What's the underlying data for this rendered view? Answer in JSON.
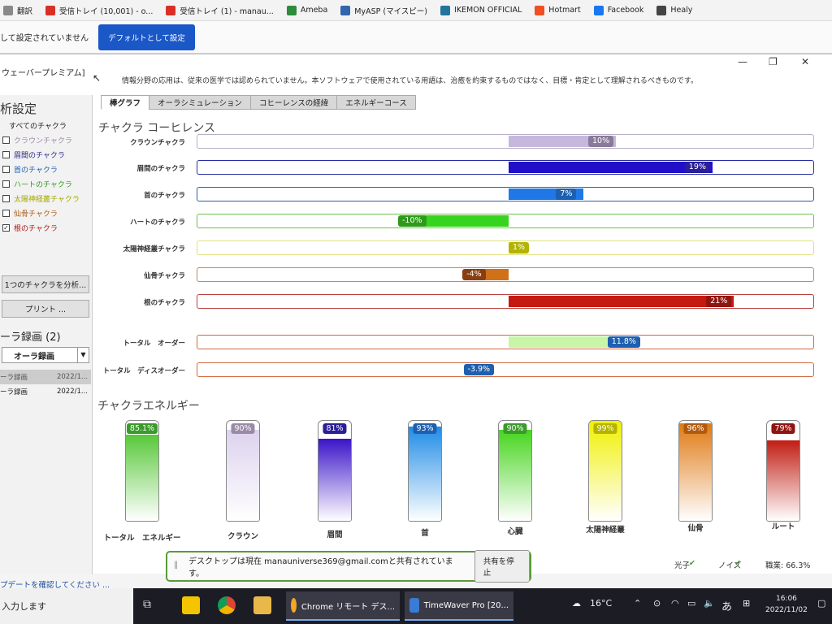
{
  "bookmarks": [
    {
      "label": "翻訳",
      "icon": "translate-icon",
      "color": "#888888"
    },
    {
      "label": "受信トレイ (10,001) - o...",
      "icon": "gmail-icon",
      "color": "#d93025"
    },
    {
      "label": "受信トレイ (1) - manau...",
      "icon": "gmail-icon",
      "color": "#d93025"
    },
    {
      "label": "Ameba",
      "icon": "ameba-icon",
      "color": "#2d8c3c"
    },
    {
      "label": "MyASP (マイスピー)",
      "icon": "myasp-icon",
      "color": "#3366aa"
    },
    {
      "label": "IKEMON OFFICIAL",
      "icon": "wordpress-icon",
      "color": "#21759b"
    },
    {
      "label": "Hotmart",
      "icon": "hotmart-icon",
      "color": "#f04e23"
    },
    {
      "label": "Facebook",
      "icon": "facebook-icon",
      "color": "#1877f2"
    },
    {
      "label": "Healy",
      "icon": "healy-icon",
      "color": "#444444"
    }
  ],
  "infobar": {
    "message": "して設定されていません",
    "button": "デフォルトとして設定"
  },
  "app": {
    "title": "ウェーバープレミアム]",
    "disclaimer": "情報分野の応用は、従来の医学では認められていません。本ソフトウェアで使用されている用語は、治癒を約束するものではなく、目標・肯定として理解されるべきものです。"
  },
  "left": {
    "section_title": "析設定",
    "checks": [
      {
        "label": "すべてのチャクラ",
        "checked": "",
        "color": "#222222"
      },
      {
        "label": "クラウンチャクラ",
        "checked": "",
        "color": "#9a8aa8"
      },
      {
        "label": "眉間のチャクラ",
        "checked": "",
        "color": "#2a2a8a"
      },
      {
        "label": "首のチャクラ",
        "checked": "",
        "color": "#1a5fb4"
      },
      {
        "label": "ハートのチャクラ",
        "checked": "",
        "color": "#2e9a1a"
      },
      {
        "label": "太陽神経叢チャクラ",
        "checked": "",
        "color": "#a8a800"
      },
      {
        "label": "仙骨チャクラ",
        "checked": "",
        "color": "#b05a10"
      },
      {
        "label": "根のチャクラ",
        "checked": "✓",
        "color": "#b01818"
      }
    ],
    "analyze_button": "1つのチャクラを分析...",
    "print_button": "プリント ...",
    "recording_title": "ーラ録画 (2)",
    "recording_select": "オーラ録画",
    "recordings": [
      {
        "name": "ーラ録画",
        "date": "2022/1..."
      },
      {
        "name": "ーラ録画",
        "date": "2022/1..."
      }
    ],
    "footer": "プデートを確認してください ..."
  },
  "tabs": [
    "棒グラフ",
    "オーラシミュレーション",
    "コヒーレンスの経緯",
    "エネルギーコース"
  ],
  "chart_data": [
    {
      "type": "bar",
      "title": "チャクラ コーヒレンス",
      "xlim": [
        -50,
        50
      ],
      "categories": [
        "クラウンチャクラ",
        "眉間のチャクラ",
        "首のチャクラ",
        "ハートのチャクラ",
        "太陽神経叢チャクラ",
        "仙骨チャクラ",
        "根のチャクラ",
        "トータル　オーダー",
        "トータル　ディスオーダー"
      ],
      "values": [
        10,
        19,
        7,
        -10,
        1,
        -4,
        21,
        11.8,
        -3.9
      ],
      "labels": [
        "10%",
        "19%",
        "7%",
        "-10%",
        "1%",
        "-4%",
        "21%",
        "11.8%",
        "-3.9%"
      ],
      "colors": [
        "#c6b8dc",
        "#1f10c8",
        "#1f78e6",
        "#36d41e",
        "#e2e200",
        "#d07018",
        "#c51a10",
        "#c9f5a8",
        "#ffffff"
      ],
      "label_colors": [
        "#8a7a9a",
        "#2a1e9a",
        "#1d5fb0",
        "#2e9a1a",
        "#b3b300",
        "#8a3e10",
        "#8e1510",
        "#1d5fb0",
        "#1d5fb0"
      ],
      "border_colors": [
        "#b8b0c8",
        "#262ea0",
        "#2b5fb0",
        "#6ec34a",
        "#e0e080",
        "#c08a60",
        "#b84040",
        "#d06a40",
        "#d06a40"
      ]
    },
    {
      "type": "bar",
      "title": "チャクラエネルギー",
      "ylim": [
        0,
        100
      ],
      "categories": [
        "トータル　エネルギー",
        "クラウン",
        "眉間",
        "首",
        "心臓",
        "太陽神経叢",
        "仙骨",
        "ルート"
      ],
      "values": [
        85.1,
        90,
        81,
        93,
        90,
        99,
        96,
        79
      ],
      "labels": [
        "85.1%",
        "90%",
        "81%",
        "93%",
        "90%",
        "99%",
        "96%",
        "79%"
      ],
      "colors": [
        "#58c83a",
        "#dcd2ee",
        "#3a14c8",
        "#1f8be6",
        "#46d51e",
        "#f0f000",
        "#e07a14",
        "#c01e14"
      ],
      "label_colors": [
        "#3a9a2a",
        "#9a8aa8",
        "#2a1e9a",
        "#1d5fb0",
        "#3a9a2a",
        "#b3b300",
        "#b05a10",
        "#8e1510"
      ]
    }
  ],
  "share": {
    "message": "デスクトップは現在 manauniverse369@gmail.comと共有されています。",
    "stop_button": "共有を停止"
  },
  "status": {
    "left": "光子",
    "mid": "ノイズ",
    "right": "職業: 66.3%"
  },
  "taskbar": {
    "search_text": "入力します",
    "apps": [
      {
        "label": "Chrome リモート デス...",
        "icon": "chrome-remote-icon"
      },
      {
        "label": "TimeWaver Pro [20...",
        "icon": "timewaver-icon"
      }
    ],
    "weather": "16°C",
    "ime": "あ",
    "time": "16:06",
    "date": "2022/11/02"
  }
}
